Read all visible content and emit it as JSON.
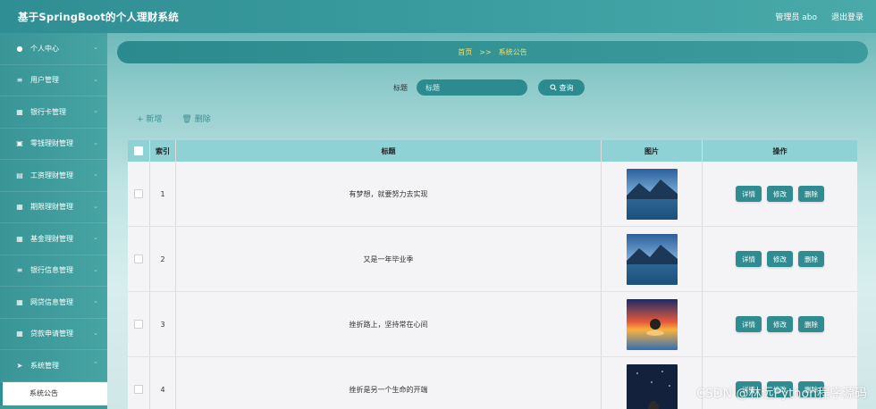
{
  "app": {
    "title": "基于SpringBoot的个人理财系统"
  },
  "topbar": {
    "user": "管理员 abo",
    "logout": "退出登录"
  },
  "sidebar": {
    "items": [
      {
        "label": "个人中心",
        "icon": "user-icon"
      },
      {
        "label": "用户管理",
        "icon": "sliders-icon"
      },
      {
        "label": "银行卡管理",
        "icon": "grid-icon"
      },
      {
        "label": "零钱理财管理",
        "icon": "bank-icon"
      },
      {
        "label": "工资理财管理",
        "icon": "card-icon"
      },
      {
        "label": "期限理财管理",
        "icon": "grid-icon"
      },
      {
        "label": "基金理财管理",
        "icon": "grid-icon"
      },
      {
        "label": "银行信息管理",
        "icon": "list-icon"
      },
      {
        "label": "网贷信息管理",
        "icon": "grid-icon"
      },
      {
        "label": "贷款申请管理",
        "icon": "grid-icon"
      },
      {
        "label": "系统管理",
        "icon": "send-icon"
      }
    ],
    "active_sub": "系统公告"
  },
  "breadcrumb": {
    "home": "首页",
    "sep": ">>",
    "current": "系统公告"
  },
  "search": {
    "label": "标题",
    "placeholder": "标题",
    "button": "查询"
  },
  "actions": {
    "add": "+ 新增",
    "delete": "删除"
  },
  "table": {
    "headers": {
      "index": "索引",
      "title": "标题",
      "image": "图片",
      "ops": "操作"
    },
    "ops": {
      "detail": "详情",
      "edit": "修改",
      "delete": "删除"
    },
    "rows": [
      {
        "index": "1",
        "title": "有梦想，就要努力去实现"
      },
      {
        "index": "2",
        "title": "又是一年毕业季"
      },
      {
        "index": "3",
        "title": "挫折路上，坚持常在心间"
      },
      {
        "index": "4",
        "title": "挫折是另一个生命的开端"
      }
    ]
  },
  "watermark": "CSDN @林远Python程序源码"
}
